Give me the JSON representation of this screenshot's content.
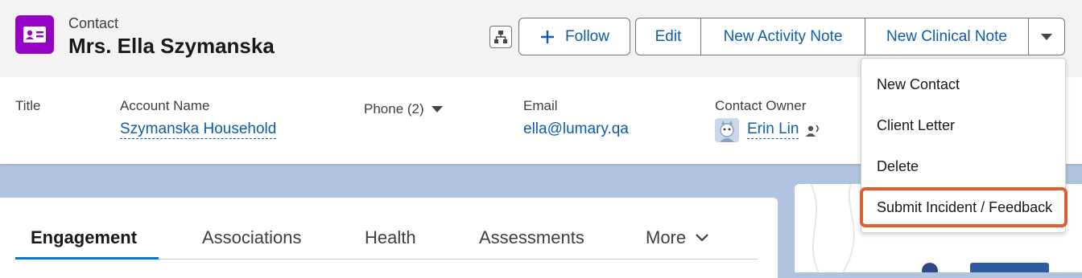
{
  "header": {
    "object_label": "Contact",
    "record_title": "Mrs. Ella Szymanska",
    "icon": "contact-card-icon",
    "icon_color": "#9602c7"
  },
  "actions": {
    "hierarchy_icon": "hierarchy-icon",
    "follow_label": "Follow",
    "edit_label": "Edit",
    "new_activity_note_label": "New Activity Note",
    "new_clinical_note_label": "New Clinical Note",
    "more_icon": "chevron-down-icon"
  },
  "highlights": {
    "title_label": "Title",
    "account_name_label": "Account Name",
    "account_name_value": "Szymanska Household",
    "phone_label": "Phone (2)",
    "email_label": "Email",
    "email_value": "ella@lumary.qa",
    "owner_label": "Contact Owner",
    "owner_value": "Erin Lin"
  },
  "tabs": [
    {
      "label": "Engagement",
      "active": true
    },
    {
      "label": "Associations"
    },
    {
      "label": "Health"
    },
    {
      "label": "Assessments"
    },
    {
      "label": "More"
    }
  ],
  "menu": {
    "items": [
      {
        "label": "New Contact"
      },
      {
        "label": "Client Letter"
      },
      {
        "label": "Delete"
      },
      {
        "label": "Submit Incident / Feedback",
        "highlighted": true
      }
    ],
    "highlight_color": "#e05f32"
  },
  "colors": {
    "link": "#0b5cab",
    "brand_blue": "#0176d3",
    "page_background": "#b0c4df"
  }
}
